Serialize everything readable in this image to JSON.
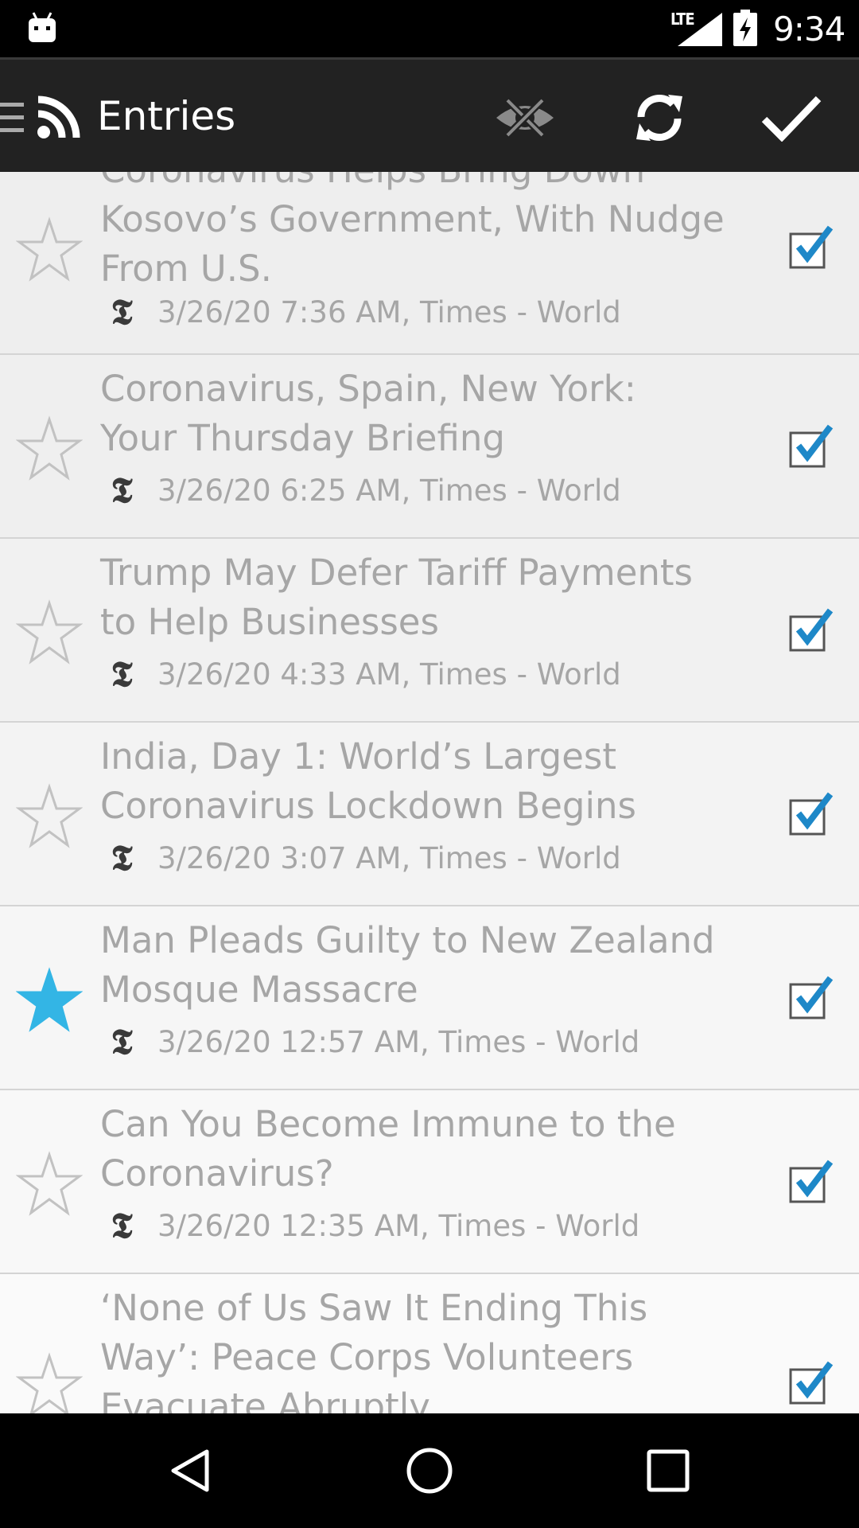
{
  "status_bar": {
    "network": "LTE",
    "time": "9:34",
    "icons": [
      "android-icon",
      "signal-icon",
      "battery-charging-icon"
    ]
  },
  "app_bar": {
    "title": "Entries",
    "icons": [
      "drawer-icon",
      "rss-icon",
      "hide-read-icon",
      "refresh-icon",
      "mark-all-read-icon"
    ]
  },
  "entries": [
    {
      "title_lines": [
        "Coronavirus Helps Bring Down",
        "Kosovo’s Government, With Nudge",
        "From U.S."
      ],
      "meta": "3/26/20 7:36 AM, Times - World",
      "source_logo": "𝕿",
      "starred": false,
      "read": true,
      "bg": "#eeeeee"
    },
    {
      "title_lines": [
        "Coronavirus, Spain, New York:",
        "Your Thursday Briefing"
      ],
      "meta": "3/26/20 6:25 AM, Times - World",
      "source_logo": "𝕿",
      "starred": false,
      "read": true,
      "bg": "#efefef"
    },
    {
      "title_lines": [
        "Trump May Defer Tariff Payments",
        "to Help Businesses"
      ],
      "meta": "3/26/20 4:33 AM, Times - World",
      "source_logo": "𝕿",
      "starred": false,
      "read": true,
      "bg": "#f1f1f1"
    },
    {
      "title_lines": [
        "India, Day 1: World’s Largest",
        "Coronavirus Lockdown Begins"
      ],
      "meta": "3/26/20 3:07 AM, Times - World",
      "source_logo": "𝕿",
      "starred": false,
      "read": true,
      "bg": "#f3f3f3"
    },
    {
      "title_lines": [
        "Man Pleads Guilty to New Zealand",
        "Mosque Massacre"
      ],
      "meta": "3/26/20 12:57 AM, Times - World",
      "source_logo": "𝕿",
      "starred": true,
      "read": true,
      "bg": "#f6f6f6"
    },
    {
      "title_lines": [
        "Can You Become Immune to the",
        "Coronavirus?"
      ],
      "meta": "3/26/20 12:35 AM, Times - World",
      "source_logo": "𝕿",
      "starred": false,
      "read": true,
      "bg": "#f8f8f8"
    },
    {
      "title_lines": [
        "‘None of Us Saw It Ending This",
        "Way’: Peace Corps Volunteers",
        "Evacuate Abruptly"
      ],
      "meta": "",
      "source_logo": "𝕿",
      "starred": false,
      "read": true,
      "bg": "#fafafa"
    }
  ],
  "nav_bar": {
    "icons": [
      "back-icon",
      "home-icon",
      "recents-icon"
    ]
  },
  "colors": {
    "accent": "#33b5e5",
    "check_blue": "#1e88c8",
    "app_bar": "#222222",
    "read_text": "#a6a6a6"
  }
}
